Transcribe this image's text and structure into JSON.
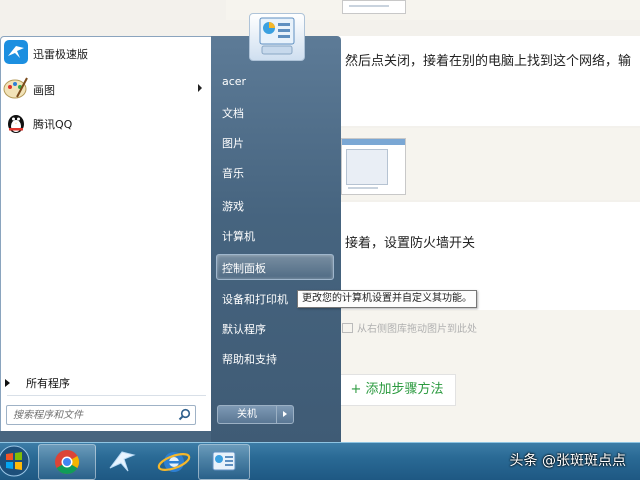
{
  "background": {
    "text_line_1": "然后点关闭，接着在别的电脑上找到这个网络，输",
    "text_line_2": "接着，设置防火墙开关",
    "upload_hint": "从右侧图库拖动图片到此处",
    "add_step_label": "+ 添加步骤方法"
  },
  "start_menu": {
    "programs": [
      {
        "label": "迅雷极速版",
        "icon": "xunlei-bird-icon",
        "has_submenu": false
      },
      {
        "label": "画图",
        "icon": "paint-palette-icon",
        "has_submenu": true
      },
      {
        "label": "腾讯QQ",
        "icon": "qq-penguin-icon",
        "has_submenu": false
      }
    ],
    "all_programs_label": "所有程序",
    "search_placeholder": "搜索程序和文件",
    "right_items": {
      "user": "acer",
      "documents": "文档",
      "pictures": "图片",
      "music": "音乐",
      "games": "游戏",
      "computer": "计算机",
      "control_panel": "控制面板",
      "devices_printers": "设备和打印机",
      "default_programs": "默认程序",
      "help_support": "帮助和支持"
    },
    "highlighted_item": "控制面板",
    "shutdown_label": "关机",
    "tooltip": "更改您的计算机设置并自定义其功能。"
  },
  "taskbar": {
    "apps": [
      "start-orb-icon",
      "chrome-icon",
      "xunlei-icon",
      "ie-browser-icon",
      "control-panel-icon"
    ],
    "watermark": "头条 @张斑斑点点"
  },
  "colors": {
    "taskbar": "#2a6a95",
    "menu_right_pane": "#4c6a86",
    "add_step_green": "#2b9a3f"
  }
}
